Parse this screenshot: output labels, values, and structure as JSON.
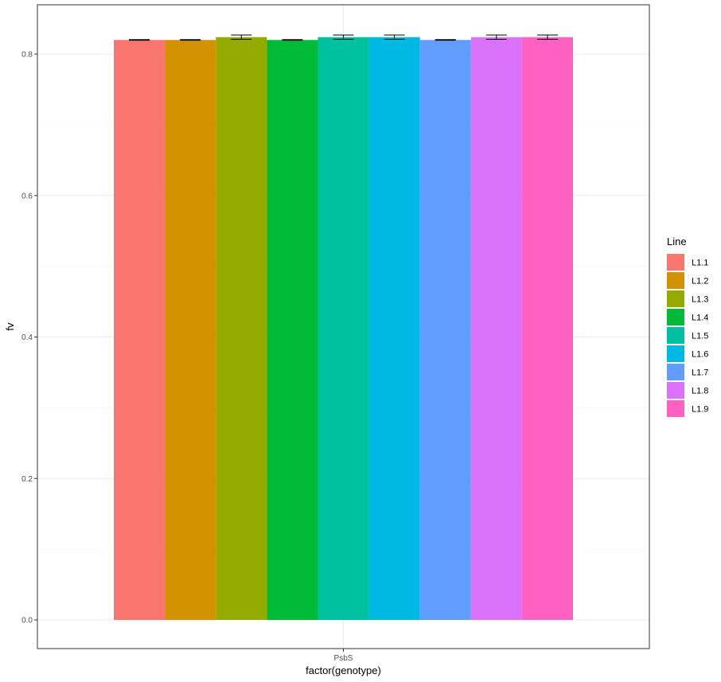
{
  "chart_data": {
    "type": "bar",
    "title": "",
    "xlabel": "factor(genotype)",
    "ylabel": "fv",
    "categories": [
      "PsbS"
    ],
    "ylim": [
      0,
      0.83
    ],
    "yticks": [
      "0.0",
      "0.2",
      "0.4",
      "0.6",
      "0.8"
    ],
    "ytick_values": [
      0.0,
      0.2,
      0.4,
      0.6,
      0.8
    ],
    "grid": true,
    "legend": {
      "title": "Line",
      "position": "right"
    },
    "series": [
      {
        "name": "L1.1",
        "values": [
          0.82
        ],
        "error": [
          0.0005
        ],
        "color": "#F8766D"
      },
      {
        "name": "L1.2",
        "values": [
          0.82
        ],
        "error": [
          0.0005
        ],
        "color": "#D39200"
      },
      {
        "name": "L1.3",
        "values": [
          0.824
        ],
        "error": [
          0.003
        ],
        "color": "#93AA00"
      },
      {
        "name": "L1.4",
        "values": [
          0.82
        ],
        "error": [
          0.0005
        ],
        "color": "#00BA38"
      },
      {
        "name": "L1.5",
        "values": [
          0.824
        ],
        "error": [
          0.003
        ],
        "color": "#00C19F"
      },
      {
        "name": "L1.6",
        "values": [
          0.824
        ],
        "error": [
          0.003
        ],
        "color": "#00B9E3"
      },
      {
        "name": "L1.7",
        "values": [
          0.82
        ],
        "error": [
          0.0005
        ],
        "color": "#619CFF"
      },
      {
        "name": "L1.8",
        "values": [
          0.824
        ],
        "error": [
          0.003
        ],
        "color": "#DB72FB"
      },
      {
        "name": "L1.9",
        "values": [
          0.824
        ],
        "error": [
          0.003
        ],
        "color": "#FF61C3"
      }
    ]
  }
}
